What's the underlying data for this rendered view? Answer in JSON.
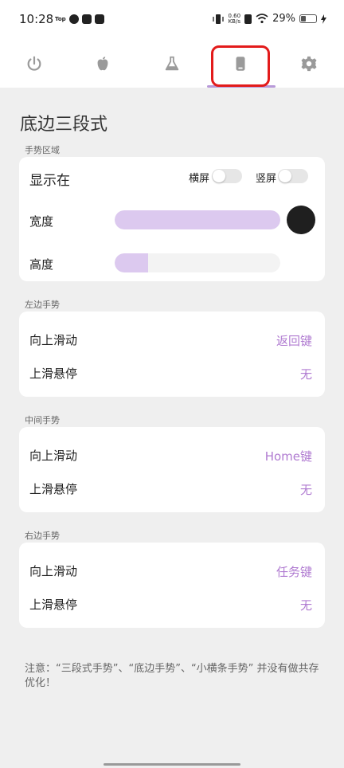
{
  "status_bar": {
    "time": "10:28",
    "left_icons": [
      "Top",
      "app-icon",
      "mail-icon",
      "tiktok-icon"
    ],
    "net_speed_value": "0.60",
    "net_speed_unit": "KB/s",
    "battery_percent": "29%"
  },
  "tabs": [
    {
      "name": "power",
      "icon": "power-icon"
    },
    {
      "name": "apple",
      "icon": "apple-icon"
    },
    {
      "name": "lab",
      "icon": "flask-icon"
    },
    {
      "name": "phone",
      "icon": "phone-icon",
      "selected": true
    },
    {
      "name": "settings",
      "icon": "gear-icon"
    }
  ],
  "page": {
    "title": "底边三段式"
  },
  "gesture_area": {
    "section_label": "手势区域",
    "display_label": "显示在",
    "landscape_label": "横屏",
    "landscape_on": false,
    "portrait_label": "竖屏",
    "portrait_on": false,
    "width_label": "宽度",
    "width_fraction": 1.0,
    "height_label": "高度",
    "height_fraction": 0.2,
    "color": "#1f1f1f"
  },
  "left_gesture": {
    "section_label": "左边手势",
    "swipe_up_label": "向上滑动",
    "swipe_up_value": "返回键",
    "hover_label": "上滑悬停",
    "hover_value": "无"
  },
  "middle_gesture": {
    "section_label": "中间手势",
    "swipe_up_label": "向上滑动",
    "swipe_up_value": "Home键",
    "hover_label": "上滑悬停",
    "hover_value": "无"
  },
  "right_gesture": {
    "section_label": "右边手势",
    "swipe_up_label": "向上滑动",
    "swipe_up_value": "任务键",
    "hover_label": "上滑悬停",
    "hover_value": "无"
  },
  "note": "注意：“三段式手势”、“底边手势”、“小横条手势” 并没有做共存优化！",
  "colors": {
    "accent": "#b07bd1",
    "slider_fill": "#dcc9ef",
    "tab_underline": "#b89ad9",
    "highlight": "#e31b1b"
  }
}
